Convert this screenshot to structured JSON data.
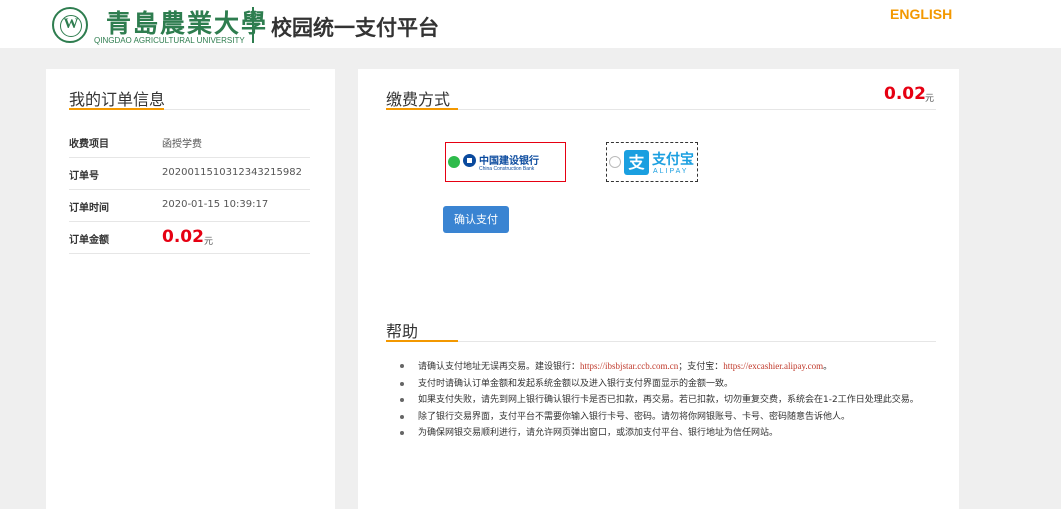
{
  "header": {
    "logo_seal_letter": "W",
    "logo_cn": "青島農業大學",
    "logo_en": "QINGDAO AGRICULTURAL UNIVERSITY",
    "platform_title": "校园统一支付平台",
    "lang_link": "ENGLISH"
  },
  "order": {
    "title": "我的订单信息",
    "rows": [
      {
        "label": "收费项目",
        "value": "函授学费"
      },
      {
        "label": "订单号",
        "value": "2020011510312343215982"
      },
      {
        "label": "订单时间",
        "value": "2020-01-15 10:39:17"
      }
    ],
    "amount_label": "订单金额",
    "amount": "0.02",
    "amount_unit": "元"
  },
  "payment": {
    "title": "缴费方式",
    "amount": "0.02",
    "amount_unit": "元",
    "ccb_cn": "中国建设银行",
    "ccb_en": "China Construction Bank",
    "alipay_mark": "支",
    "alipay_cn": "支付宝",
    "alipay_en": "ALIPAY",
    "confirm_label": "确认支付"
  },
  "help": {
    "title": "帮助",
    "items": {
      "0": {
        "text_a": "请确认支付地址无误再交易。建设银行：",
        "link_ccb": "https://ibsbjstar.ccb.com.cn",
        "text_b": "；支付宝：",
        "link_alipay": "https://excashier.alipay.com",
        "text_c": "。"
      },
      "1": "支付时请确认订单金额和发起系统金额以及进入银行支付界面显示的金额一致。",
      "2": "如果支付失败，请先到网上银行确认银行卡是否已扣款，再交易。若已扣款，切勿重复交费，系统会在1-2工作日处理此交易。",
      "3": "除了银行交易界面，支付平台不需要你输入银行卡号、密码。请勿将你网银账号、卡号、密码随意告诉他人。",
      "4": "为确保网银交易顺利进行，请允许网页弹出窗口，或添加支付平台、银行地址为信任网站。"
    }
  },
  "colors": {
    "accent_orange": "#f39800",
    "amount_red": "#e60012",
    "brand_green": "#2e7d4f",
    "button_blue": "#3a84d2",
    "radio_green": "#2ebb4b"
  }
}
